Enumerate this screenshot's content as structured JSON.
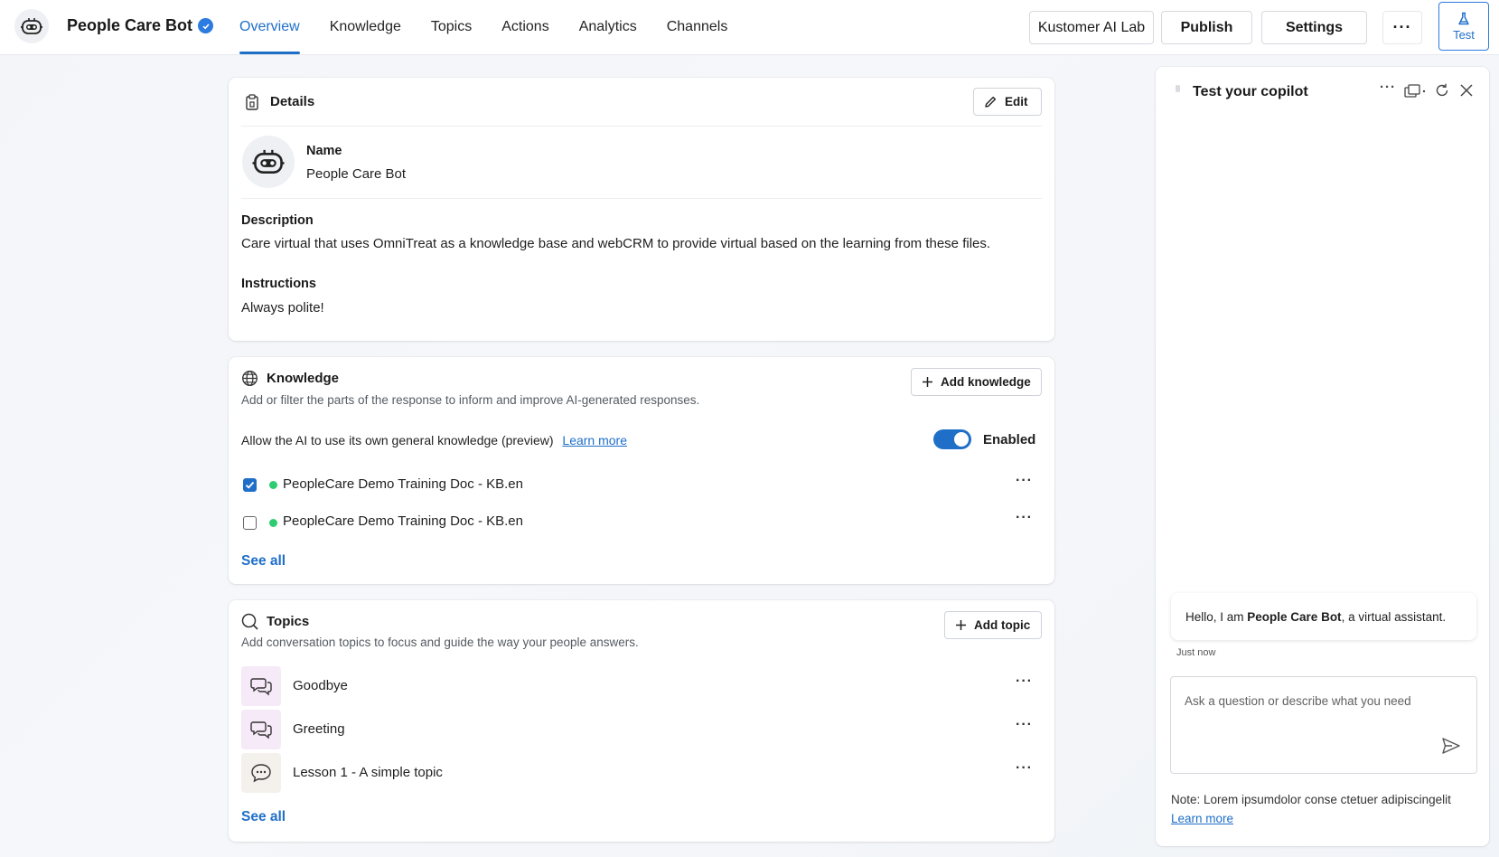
{
  "header": {
    "bot_name": "People Care Bot",
    "tabs": [
      {
        "label": "Overview"
      },
      {
        "label": "Knowledge"
      },
      {
        "label": "Topics"
      },
      {
        "label": "Actions"
      },
      {
        "label": "Analytics"
      },
      {
        "label": "Channels"
      }
    ],
    "lab_button": "Kustomer AI Lab",
    "publish_button": "Publish",
    "settings_button": "Settings",
    "test_button": "Test"
  },
  "details": {
    "title": "Details",
    "edit_button": "Edit",
    "name_label": "Name",
    "name_value": "People Care Bot",
    "description_label": "Description",
    "description_value": "Care virtual that uses OmniTreat as a knowledge base and webCRM to provide virtual based on the learning from these files.",
    "instructions_label": "Instructions",
    "instructions_value": "Always polite!"
  },
  "knowledge": {
    "title": "Knowledge",
    "subtitle": "Add or filter the parts of the response to inform and improve AI-generated responses.",
    "add_button": "Add knowledge",
    "general_text": "Allow the AI to use its own general knowledge (preview)",
    "learn_more": "Learn more",
    "toggle_label": "Enabled",
    "items": [
      {
        "label": "PeopleCare Demo Training Doc - KB.en",
        "checked": true
      },
      {
        "label": "PeopleCare Demo Training Doc - KB.en",
        "checked": false
      }
    ],
    "see_all": "See all"
  },
  "topics": {
    "title": "Topics",
    "subtitle": "Add conversation topics to focus and guide the way your people answers.",
    "add_button": "Add topic",
    "items": [
      {
        "label": "Goodbye"
      },
      {
        "label": "Greeting"
      },
      {
        "label": "Lesson 1 - A simple topic"
      }
    ],
    "see_all": "See all"
  },
  "test_panel": {
    "title": "Test your copilot",
    "greeting_prefix": "Hello, I am ",
    "greeting_bold": "People Care Bot",
    "greeting_suffix": ", a virtual assistant.",
    "timestamp": "Just now",
    "input_placeholder": "Ask a question or describe what you need",
    "note": "Note: Lorem ipsumdolor conse ctetuer adipiscingelit",
    "learn_more": "Learn more"
  },
  "colors": {
    "accent": "#1f6fc9",
    "status_green": "#2ecc71",
    "topic_tile_pink": "#f6e9f8",
    "topic_tile_beige": "#f4f1ec"
  }
}
